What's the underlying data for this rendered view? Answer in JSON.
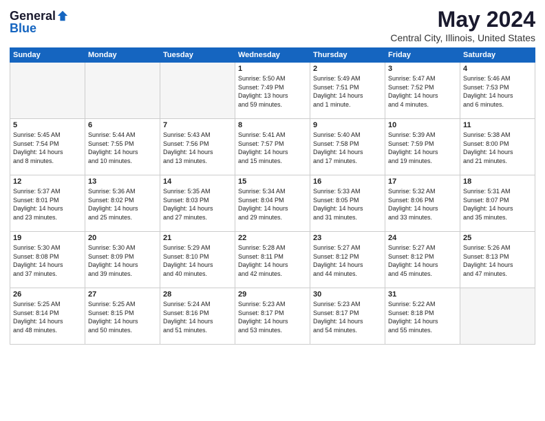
{
  "header": {
    "logo_general": "General",
    "logo_blue": "Blue",
    "main_title": "May 2024",
    "subtitle": "Central City, Illinois, United States"
  },
  "days_of_week": [
    "Sunday",
    "Monday",
    "Tuesday",
    "Wednesday",
    "Thursday",
    "Friday",
    "Saturday"
  ],
  "weeks": [
    [
      {
        "day": "",
        "info": ""
      },
      {
        "day": "",
        "info": ""
      },
      {
        "day": "",
        "info": ""
      },
      {
        "day": "1",
        "info": "Sunrise: 5:50 AM\nSunset: 7:49 PM\nDaylight: 13 hours\nand 59 minutes."
      },
      {
        "day": "2",
        "info": "Sunrise: 5:49 AM\nSunset: 7:51 PM\nDaylight: 14 hours\nand 1 minute."
      },
      {
        "day": "3",
        "info": "Sunrise: 5:47 AM\nSunset: 7:52 PM\nDaylight: 14 hours\nand 4 minutes."
      },
      {
        "day": "4",
        "info": "Sunrise: 5:46 AM\nSunset: 7:53 PM\nDaylight: 14 hours\nand 6 minutes."
      }
    ],
    [
      {
        "day": "5",
        "info": "Sunrise: 5:45 AM\nSunset: 7:54 PM\nDaylight: 14 hours\nand 8 minutes."
      },
      {
        "day": "6",
        "info": "Sunrise: 5:44 AM\nSunset: 7:55 PM\nDaylight: 14 hours\nand 10 minutes."
      },
      {
        "day": "7",
        "info": "Sunrise: 5:43 AM\nSunset: 7:56 PM\nDaylight: 14 hours\nand 13 minutes."
      },
      {
        "day": "8",
        "info": "Sunrise: 5:41 AM\nSunset: 7:57 PM\nDaylight: 14 hours\nand 15 minutes."
      },
      {
        "day": "9",
        "info": "Sunrise: 5:40 AM\nSunset: 7:58 PM\nDaylight: 14 hours\nand 17 minutes."
      },
      {
        "day": "10",
        "info": "Sunrise: 5:39 AM\nSunset: 7:59 PM\nDaylight: 14 hours\nand 19 minutes."
      },
      {
        "day": "11",
        "info": "Sunrise: 5:38 AM\nSunset: 8:00 PM\nDaylight: 14 hours\nand 21 minutes."
      }
    ],
    [
      {
        "day": "12",
        "info": "Sunrise: 5:37 AM\nSunset: 8:01 PM\nDaylight: 14 hours\nand 23 minutes."
      },
      {
        "day": "13",
        "info": "Sunrise: 5:36 AM\nSunset: 8:02 PM\nDaylight: 14 hours\nand 25 minutes."
      },
      {
        "day": "14",
        "info": "Sunrise: 5:35 AM\nSunset: 8:03 PM\nDaylight: 14 hours\nand 27 minutes."
      },
      {
        "day": "15",
        "info": "Sunrise: 5:34 AM\nSunset: 8:04 PM\nDaylight: 14 hours\nand 29 minutes."
      },
      {
        "day": "16",
        "info": "Sunrise: 5:33 AM\nSunset: 8:05 PM\nDaylight: 14 hours\nand 31 minutes."
      },
      {
        "day": "17",
        "info": "Sunrise: 5:32 AM\nSunset: 8:06 PM\nDaylight: 14 hours\nand 33 minutes."
      },
      {
        "day": "18",
        "info": "Sunrise: 5:31 AM\nSunset: 8:07 PM\nDaylight: 14 hours\nand 35 minutes."
      }
    ],
    [
      {
        "day": "19",
        "info": "Sunrise: 5:30 AM\nSunset: 8:08 PM\nDaylight: 14 hours\nand 37 minutes."
      },
      {
        "day": "20",
        "info": "Sunrise: 5:30 AM\nSunset: 8:09 PM\nDaylight: 14 hours\nand 39 minutes."
      },
      {
        "day": "21",
        "info": "Sunrise: 5:29 AM\nSunset: 8:10 PM\nDaylight: 14 hours\nand 40 minutes."
      },
      {
        "day": "22",
        "info": "Sunrise: 5:28 AM\nSunset: 8:11 PM\nDaylight: 14 hours\nand 42 minutes."
      },
      {
        "day": "23",
        "info": "Sunrise: 5:27 AM\nSunset: 8:12 PM\nDaylight: 14 hours\nand 44 minutes."
      },
      {
        "day": "24",
        "info": "Sunrise: 5:27 AM\nSunset: 8:12 PM\nDaylight: 14 hours\nand 45 minutes."
      },
      {
        "day": "25",
        "info": "Sunrise: 5:26 AM\nSunset: 8:13 PM\nDaylight: 14 hours\nand 47 minutes."
      }
    ],
    [
      {
        "day": "26",
        "info": "Sunrise: 5:25 AM\nSunset: 8:14 PM\nDaylight: 14 hours\nand 48 minutes."
      },
      {
        "day": "27",
        "info": "Sunrise: 5:25 AM\nSunset: 8:15 PM\nDaylight: 14 hours\nand 50 minutes."
      },
      {
        "day": "28",
        "info": "Sunrise: 5:24 AM\nSunset: 8:16 PM\nDaylight: 14 hours\nand 51 minutes."
      },
      {
        "day": "29",
        "info": "Sunrise: 5:23 AM\nSunset: 8:17 PM\nDaylight: 14 hours\nand 53 minutes."
      },
      {
        "day": "30",
        "info": "Sunrise: 5:23 AM\nSunset: 8:17 PM\nDaylight: 14 hours\nand 54 minutes."
      },
      {
        "day": "31",
        "info": "Sunrise: 5:22 AM\nSunset: 8:18 PM\nDaylight: 14 hours\nand 55 minutes."
      },
      {
        "day": "",
        "info": ""
      }
    ]
  ]
}
